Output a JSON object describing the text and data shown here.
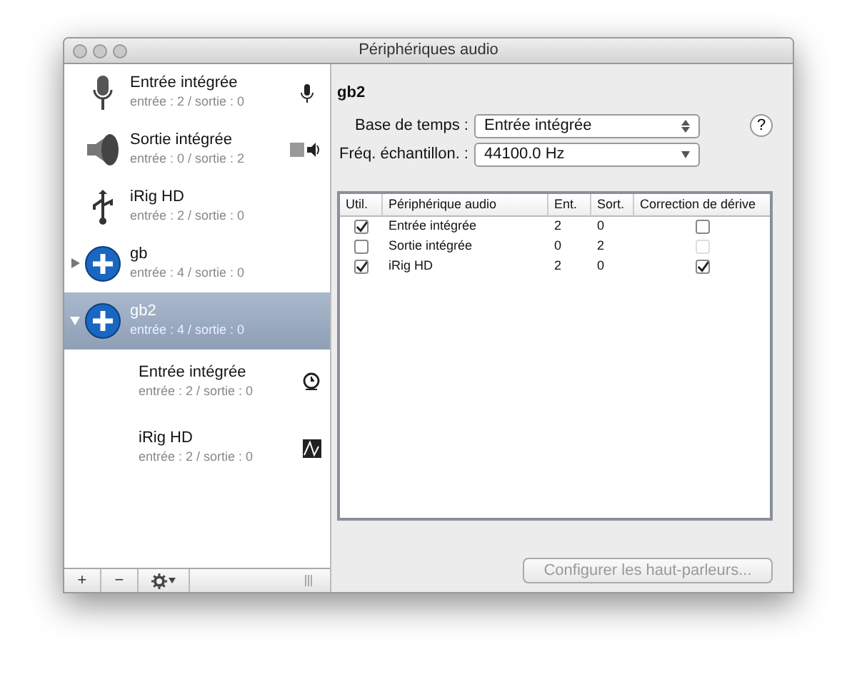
{
  "window": {
    "title": "Périphériques audio"
  },
  "devices": [
    {
      "name": "Entrée intégrée",
      "detail": "entrée : 2 / sortie : 0",
      "kind": "microphone",
      "badge": {
        "kind": "input"
      },
      "selected": false
    },
    {
      "name": "Sortie intégrée",
      "detail": "entrée : 0 / sortie : 2",
      "kind": "speaker",
      "badge": {
        "kind": "output"
      },
      "selected": false
    },
    {
      "name": "iRig HD",
      "detail": "entrée : 2 / sortie : 0",
      "kind": "usb",
      "selected": false
    },
    {
      "name": "gb",
      "detail": "entrée : 4 / sortie : 0",
      "kind": "aggregate",
      "selected": false,
      "expanded": false
    },
    {
      "name": "gb2",
      "detail": "entrée : 4 / sortie : 0",
      "kind": "aggregate",
      "selected": true,
      "expanded": true,
      "children": [
        {
          "name": "Entrée intégrée",
          "detail": "entrée : 2 / sortie : 0",
          "badge": {
            "kind": "clock"
          }
        },
        {
          "name": "iRig HD",
          "detail": "entrée : 2 / sortie : 0",
          "badge": {
            "kind": "wave"
          }
        }
      ]
    }
  ],
  "detail": {
    "title": "gb2",
    "clock_label": "Base de temps :",
    "clock_value": "Entrée intégrée",
    "rate_label": "Fréq. échantillon. :",
    "rate_value": "44100.0 Hz",
    "help_button": "?",
    "table": {
      "columns": [
        "Util.",
        "Périphérique audio",
        "Ent.",
        "Sort.",
        "Correction de dérive"
      ],
      "rows": [
        {
          "used": true,
          "name": "Entrée intégrée",
          "inputs": "2",
          "outputs": "0",
          "drift": false,
          "drift_disabled": false
        },
        {
          "used": false,
          "name": "Sortie intégrée",
          "inputs": "0",
          "outputs": "2",
          "drift": false,
          "drift_disabled": true
        },
        {
          "used": true,
          "name": "iRig HD",
          "inputs": "2",
          "outputs": "0",
          "drift": true,
          "drift_disabled": false
        }
      ]
    },
    "configure_button": "Configurer les haut-parleurs..."
  },
  "toolbar": {
    "add": "+",
    "remove": "−"
  }
}
